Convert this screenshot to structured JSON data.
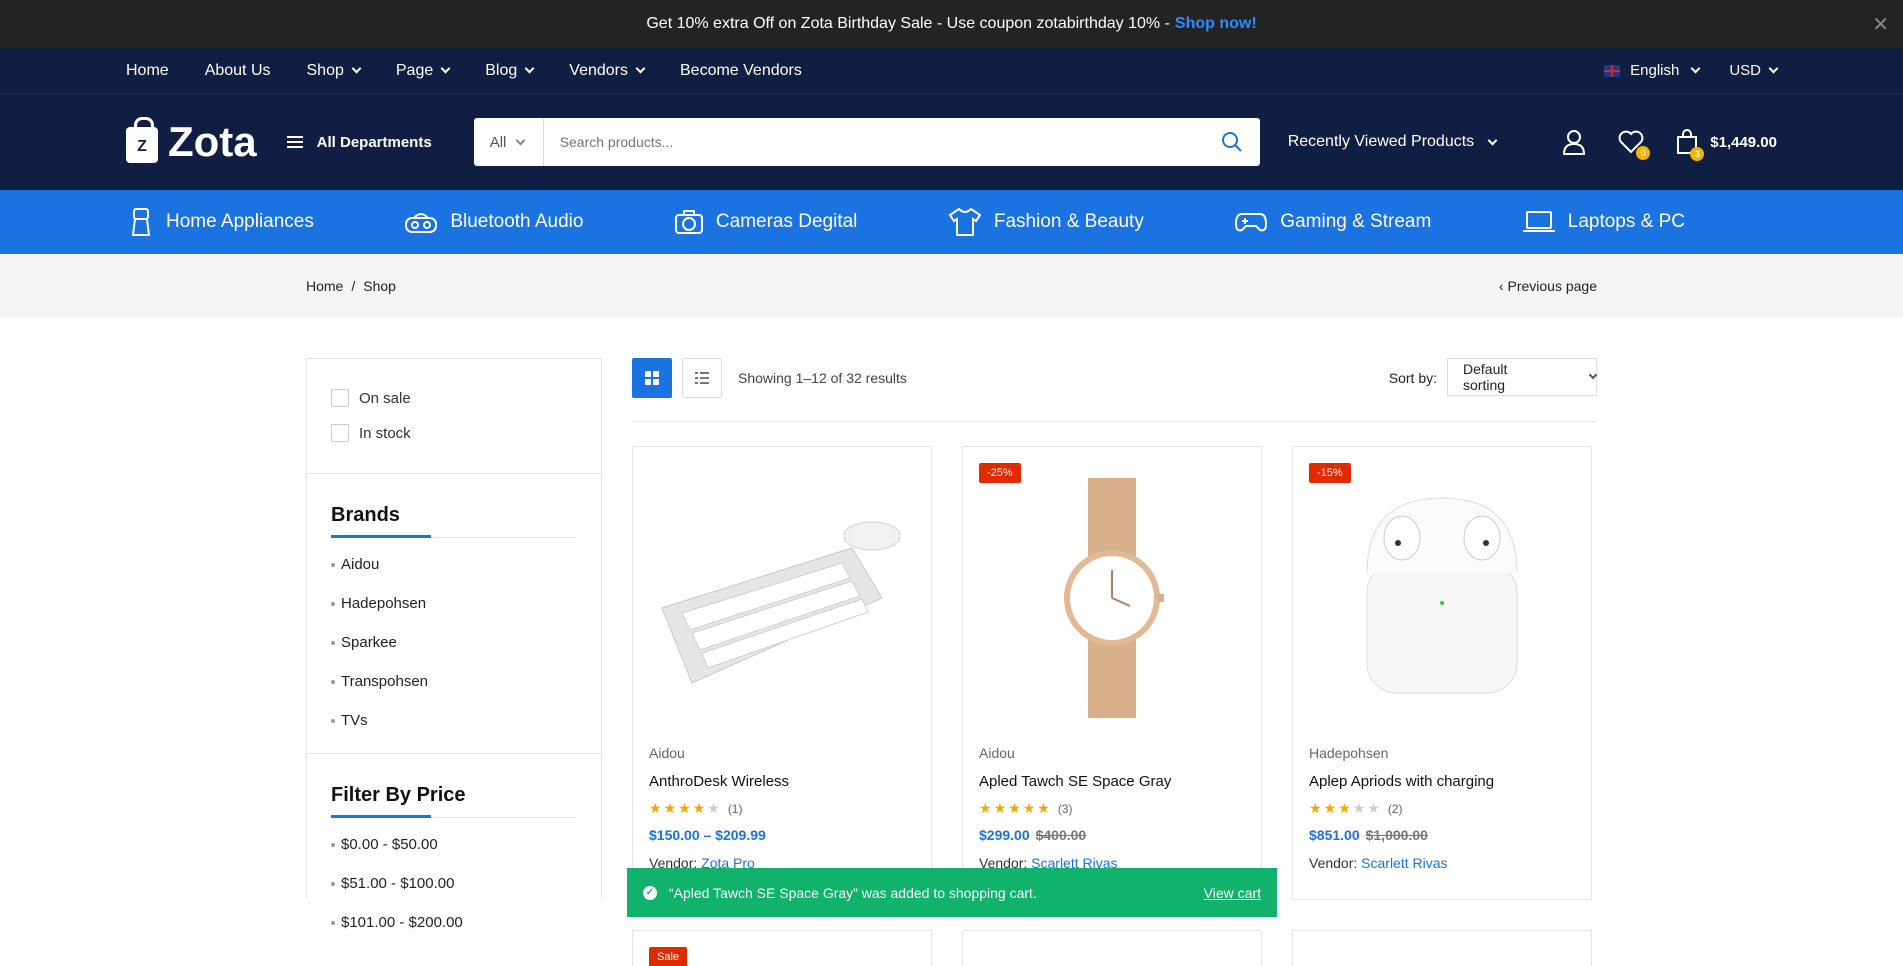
{
  "promo": {
    "text": "Get 10% extra Off on Zota Birthday Sale - Use coupon zotabirthday 10% -",
    "link": "Shop now!",
    "close": "✕"
  },
  "nav": {
    "items": [
      {
        "label": "Home"
      },
      {
        "label": "About Us"
      },
      {
        "label": "Shop"
      },
      {
        "label": "Page"
      },
      {
        "label": "Blog"
      },
      {
        "label": "Vendors"
      },
      {
        "label": "Become Vendors"
      }
    ],
    "language": "English",
    "currency": "USD"
  },
  "header": {
    "logo": "Zota",
    "logo_mark": "Z",
    "departments": "All Departments",
    "search_category": "All",
    "search_placeholder": "Search products...",
    "recent": "Recently Viewed Products",
    "wishlist_count": "0",
    "cart_count": "3",
    "cart_total": "$1,449.00"
  },
  "categories": [
    {
      "label": "Home Appliances",
      "icon": "appliance-icon"
    },
    {
      "label": "Bluetooth Audio",
      "icon": "speaker-icon"
    },
    {
      "label": "Cameras Degital",
      "icon": "camera-icon"
    },
    {
      "label": "Fashion & Beauty",
      "icon": "shirt-icon"
    },
    {
      "label": "Gaming & Stream",
      "icon": "gamepad-icon"
    },
    {
      "label": "Laptops & PC",
      "icon": "laptop-icon"
    }
  ],
  "breadcrumb": {
    "home": "Home",
    "sep": "/",
    "current": "Shop",
    "previous": "Previous page"
  },
  "filters": {
    "on_sale": "On sale",
    "in_stock": "In stock"
  },
  "brands": {
    "title": "Brands",
    "items": [
      "Aidou",
      "Hadepohsen",
      "Sparkee",
      "Transpohsen",
      "TVs"
    ]
  },
  "price_filter": {
    "title": "Filter By Price",
    "items": [
      "$0.00 - $50.00",
      "$51.00 - $100.00",
      "$101.00 - $200.00"
    ]
  },
  "toolbar": {
    "showing": "Showing 1–12 of 32 results",
    "sort_label": "Sort by:",
    "sort_value": "Default sorting"
  },
  "products": [
    {
      "brand": "Aidou",
      "name": "AnthroDesk Wireless",
      "rating": 4,
      "reviews": "(1)",
      "price": "$150.00 – $209.99",
      "old_price": "",
      "vendor_label": "Vendor:",
      "vendor": "Zota Pro",
      "badge": ""
    },
    {
      "brand": "Aidou",
      "name": "Apled Tawch SE Space Gray",
      "rating": 5,
      "reviews": "(3)",
      "price": "$299.00",
      "old_price": "$400.00",
      "vendor_label": "Vendor:",
      "vendor": "Scarlett Rivas",
      "badge": "-25%"
    },
    {
      "brand": "Hadepohsen",
      "name": "Aplep Apriods with charging",
      "rating": 3,
      "reviews": "(2)",
      "price": "$851.00",
      "old_price": "$1,000.00",
      "vendor_label": "Vendor:",
      "vendor": "Scarlett Rivas",
      "badge": "-15%"
    }
  ],
  "row2_badge": "Sale",
  "toast": {
    "message": "“Apled Tawch SE Space Gray” was added to shopping cart.",
    "action": "View cart"
  }
}
